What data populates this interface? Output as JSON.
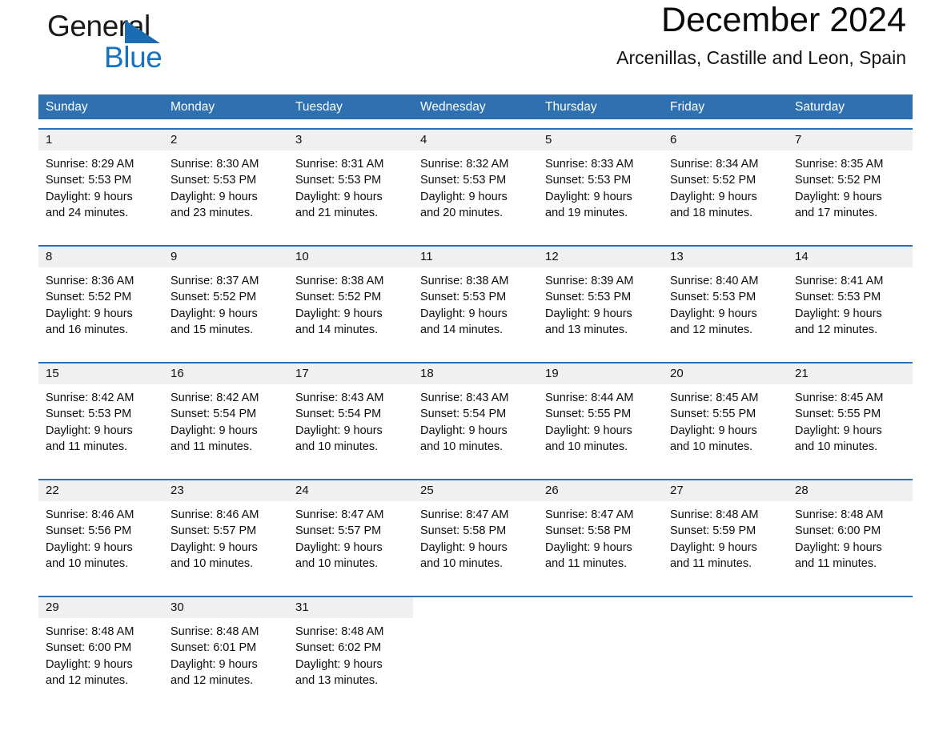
{
  "brand": {
    "name_part1": "General",
    "name_part2": "Blue",
    "triangle_color": "#1B6CB0",
    "blue_color": "#1472C4"
  },
  "header": {
    "month_title": "December 2024",
    "location": "Arcenillas, Castille and Leon, Spain"
  },
  "theme": {
    "header_blue": "#2E70B0",
    "date_band_gray": "#F0F0F0",
    "row_divider_blue": "#2E70B0"
  },
  "calendar": {
    "weekdays": [
      "Sunday",
      "Monday",
      "Tuesday",
      "Wednesday",
      "Thursday",
      "Friday",
      "Saturday"
    ],
    "weeks": [
      [
        {
          "date": "1",
          "sunrise": "Sunrise: 8:29 AM",
          "sunset": "Sunset: 5:53 PM",
          "daylight_line1": "Daylight: 9 hours",
          "daylight_line2": "and 24 minutes."
        },
        {
          "date": "2",
          "sunrise": "Sunrise: 8:30 AM",
          "sunset": "Sunset: 5:53 PM",
          "daylight_line1": "Daylight: 9 hours",
          "daylight_line2": "and 23 minutes."
        },
        {
          "date": "3",
          "sunrise": "Sunrise: 8:31 AM",
          "sunset": "Sunset: 5:53 PM",
          "daylight_line1": "Daylight: 9 hours",
          "daylight_line2": "and 21 minutes."
        },
        {
          "date": "4",
          "sunrise": "Sunrise: 8:32 AM",
          "sunset": "Sunset: 5:53 PM",
          "daylight_line1": "Daylight: 9 hours",
          "daylight_line2": "and 20 minutes."
        },
        {
          "date": "5",
          "sunrise": "Sunrise: 8:33 AM",
          "sunset": "Sunset: 5:53 PM",
          "daylight_line1": "Daylight: 9 hours",
          "daylight_line2": "and 19 minutes."
        },
        {
          "date": "6",
          "sunrise": "Sunrise: 8:34 AM",
          "sunset": "Sunset: 5:52 PM",
          "daylight_line1": "Daylight: 9 hours",
          "daylight_line2": "and 18 minutes."
        },
        {
          "date": "7",
          "sunrise": "Sunrise: 8:35 AM",
          "sunset": "Sunset: 5:52 PM",
          "daylight_line1": "Daylight: 9 hours",
          "daylight_line2": "and 17 minutes."
        }
      ],
      [
        {
          "date": "8",
          "sunrise": "Sunrise: 8:36 AM",
          "sunset": "Sunset: 5:52 PM",
          "daylight_line1": "Daylight: 9 hours",
          "daylight_line2": "and 16 minutes."
        },
        {
          "date": "9",
          "sunrise": "Sunrise: 8:37 AM",
          "sunset": "Sunset: 5:52 PM",
          "daylight_line1": "Daylight: 9 hours",
          "daylight_line2": "and 15 minutes."
        },
        {
          "date": "10",
          "sunrise": "Sunrise: 8:38 AM",
          "sunset": "Sunset: 5:52 PM",
          "daylight_line1": "Daylight: 9 hours",
          "daylight_line2": "and 14 minutes."
        },
        {
          "date": "11",
          "sunrise": "Sunrise: 8:38 AM",
          "sunset": "Sunset: 5:53 PM",
          "daylight_line1": "Daylight: 9 hours",
          "daylight_line2": "and 14 minutes."
        },
        {
          "date": "12",
          "sunrise": "Sunrise: 8:39 AM",
          "sunset": "Sunset: 5:53 PM",
          "daylight_line1": "Daylight: 9 hours",
          "daylight_line2": "and 13 minutes."
        },
        {
          "date": "13",
          "sunrise": "Sunrise: 8:40 AM",
          "sunset": "Sunset: 5:53 PM",
          "daylight_line1": "Daylight: 9 hours",
          "daylight_line2": "and 12 minutes."
        },
        {
          "date": "14",
          "sunrise": "Sunrise: 8:41 AM",
          "sunset": "Sunset: 5:53 PM",
          "daylight_line1": "Daylight: 9 hours",
          "daylight_line2": "and 12 minutes."
        }
      ],
      [
        {
          "date": "15",
          "sunrise": "Sunrise: 8:42 AM",
          "sunset": "Sunset: 5:53 PM",
          "daylight_line1": "Daylight: 9 hours",
          "daylight_line2": "and 11 minutes."
        },
        {
          "date": "16",
          "sunrise": "Sunrise: 8:42 AM",
          "sunset": "Sunset: 5:54 PM",
          "daylight_line1": "Daylight: 9 hours",
          "daylight_line2": "and 11 minutes."
        },
        {
          "date": "17",
          "sunrise": "Sunrise: 8:43 AM",
          "sunset": "Sunset: 5:54 PM",
          "daylight_line1": "Daylight: 9 hours",
          "daylight_line2": "and 10 minutes."
        },
        {
          "date": "18",
          "sunrise": "Sunrise: 8:43 AM",
          "sunset": "Sunset: 5:54 PM",
          "daylight_line1": "Daylight: 9 hours",
          "daylight_line2": "and 10 minutes."
        },
        {
          "date": "19",
          "sunrise": "Sunrise: 8:44 AM",
          "sunset": "Sunset: 5:55 PM",
          "daylight_line1": "Daylight: 9 hours",
          "daylight_line2": "and 10 minutes."
        },
        {
          "date": "20",
          "sunrise": "Sunrise: 8:45 AM",
          "sunset": "Sunset: 5:55 PM",
          "daylight_line1": "Daylight: 9 hours",
          "daylight_line2": "and 10 minutes."
        },
        {
          "date": "21",
          "sunrise": "Sunrise: 8:45 AM",
          "sunset": "Sunset: 5:55 PM",
          "daylight_line1": "Daylight: 9 hours",
          "daylight_line2": "and 10 minutes."
        }
      ],
      [
        {
          "date": "22",
          "sunrise": "Sunrise: 8:46 AM",
          "sunset": "Sunset: 5:56 PM",
          "daylight_line1": "Daylight: 9 hours",
          "daylight_line2": "and 10 minutes."
        },
        {
          "date": "23",
          "sunrise": "Sunrise: 8:46 AM",
          "sunset": "Sunset: 5:57 PM",
          "daylight_line1": "Daylight: 9 hours",
          "daylight_line2": "and 10 minutes."
        },
        {
          "date": "24",
          "sunrise": "Sunrise: 8:47 AM",
          "sunset": "Sunset: 5:57 PM",
          "daylight_line1": "Daylight: 9 hours",
          "daylight_line2": "and 10 minutes."
        },
        {
          "date": "25",
          "sunrise": "Sunrise: 8:47 AM",
          "sunset": "Sunset: 5:58 PM",
          "daylight_line1": "Daylight: 9 hours",
          "daylight_line2": "and 10 minutes."
        },
        {
          "date": "26",
          "sunrise": "Sunrise: 8:47 AM",
          "sunset": "Sunset: 5:58 PM",
          "daylight_line1": "Daylight: 9 hours",
          "daylight_line2": "and 11 minutes."
        },
        {
          "date": "27",
          "sunrise": "Sunrise: 8:48 AM",
          "sunset": "Sunset: 5:59 PM",
          "daylight_line1": "Daylight: 9 hours",
          "daylight_line2": "and 11 minutes."
        },
        {
          "date": "28",
          "sunrise": "Sunrise: 8:48 AM",
          "sunset": "Sunset: 6:00 PM",
          "daylight_line1": "Daylight: 9 hours",
          "daylight_line2": "and 11 minutes."
        }
      ],
      [
        {
          "date": "29",
          "sunrise": "Sunrise: 8:48 AM",
          "sunset": "Sunset: 6:00 PM",
          "daylight_line1": "Daylight: 9 hours",
          "daylight_line2": "and 12 minutes."
        },
        {
          "date": "30",
          "sunrise": "Sunrise: 8:48 AM",
          "sunset": "Sunset: 6:01 PM",
          "daylight_line1": "Daylight: 9 hours",
          "daylight_line2": "and 12 minutes."
        },
        {
          "date": "31",
          "sunrise": "Sunrise: 8:48 AM",
          "sunset": "Sunset: 6:02 PM",
          "daylight_line1": "Daylight: 9 hours",
          "daylight_line2": "and 13 minutes."
        },
        {
          "date": "",
          "sunrise": "",
          "sunset": "",
          "daylight_line1": "",
          "daylight_line2": ""
        },
        {
          "date": "",
          "sunrise": "",
          "sunset": "",
          "daylight_line1": "",
          "daylight_line2": ""
        },
        {
          "date": "",
          "sunrise": "",
          "sunset": "",
          "daylight_line1": "",
          "daylight_line2": ""
        },
        {
          "date": "",
          "sunrise": "",
          "sunset": "",
          "daylight_line1": "",
          "daylight_line2": ""
        }
      ]
    ]
  }
}
